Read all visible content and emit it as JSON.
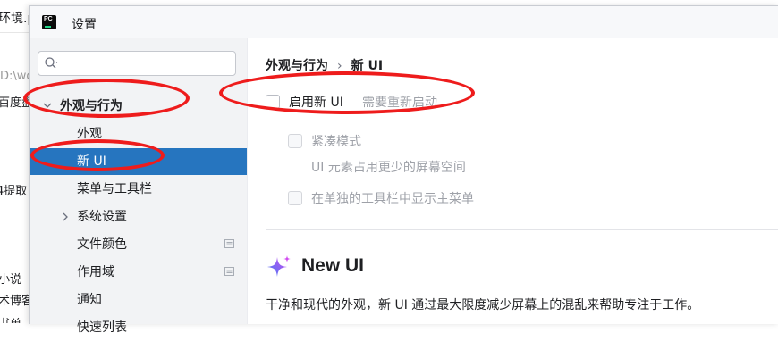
{
  "background_window": {
    "title_fragment": "环境.p",
    "lines": [
      "D:\\wo",
      "百度盘",
      "4提取",
      "小说",
      "术博客",
      "书单"
    ]
  },
  "dialog": {
    "title": "设置",
    "app_icon_text": "PC"
  },
  "search": {
    "value": "",
    "placeholder": ""
  },
  "sidebar": {
    "items": [
      {
        "label": "外观与行为"
      },
      {
        "label": "外观"
      },
      {
        "label": "新 UI"
      },
      {
        "label": "菜单与工具栏"
      },
      {
        "label": "系统设置"
      },
      {
        "label": "文件颜色"
      },
      {
        "label": "作用域"
      },
      {
        "label": "通知"
      },
      {
        "label": "快速列表"
      }
    ]
  },
  "content": {
    "breadcrumb": {
      "parent": "外观与行为",
      "separator": "›",
      "current": "新 UI"
    },
    "enable_new_ui": {
      "label": "启用新 UI",
      "note": "需要重新启动",
      "checked": false
    },
    "compact_mode": {
      "label": "紧凑模式",
      "description": "UI 元素占用更少的屏幕空间",
      "checked": false
    },
    "separate_toolbar_menu": {
      "label": "在单独的工具栏中显示主菜单",
      "checked": false
    },
    "promo": {
      "title": "New UI",
      "description": "干净和现代的外观，新 UI 通过最大限度减少屏幕上的混乱来帮助专注于工作。"
    }
  },
  "colors": {
    "selection": "#2675bf",
    "annotation": "#ee1c1c",
    "sidebar_bg": "#f2f3f5",
    "promo_gradient_start": "#3d7cf5",
    "promo_gradient_end": "#d14cf0"
  },
  "icons": [
    "pycharm-app-icon",
    "search-icon",
    "chevron-down-icon",
    "chevron-right-icon",
    "scope-badge-icon",
    "sparkle-icon"
  ]
}
